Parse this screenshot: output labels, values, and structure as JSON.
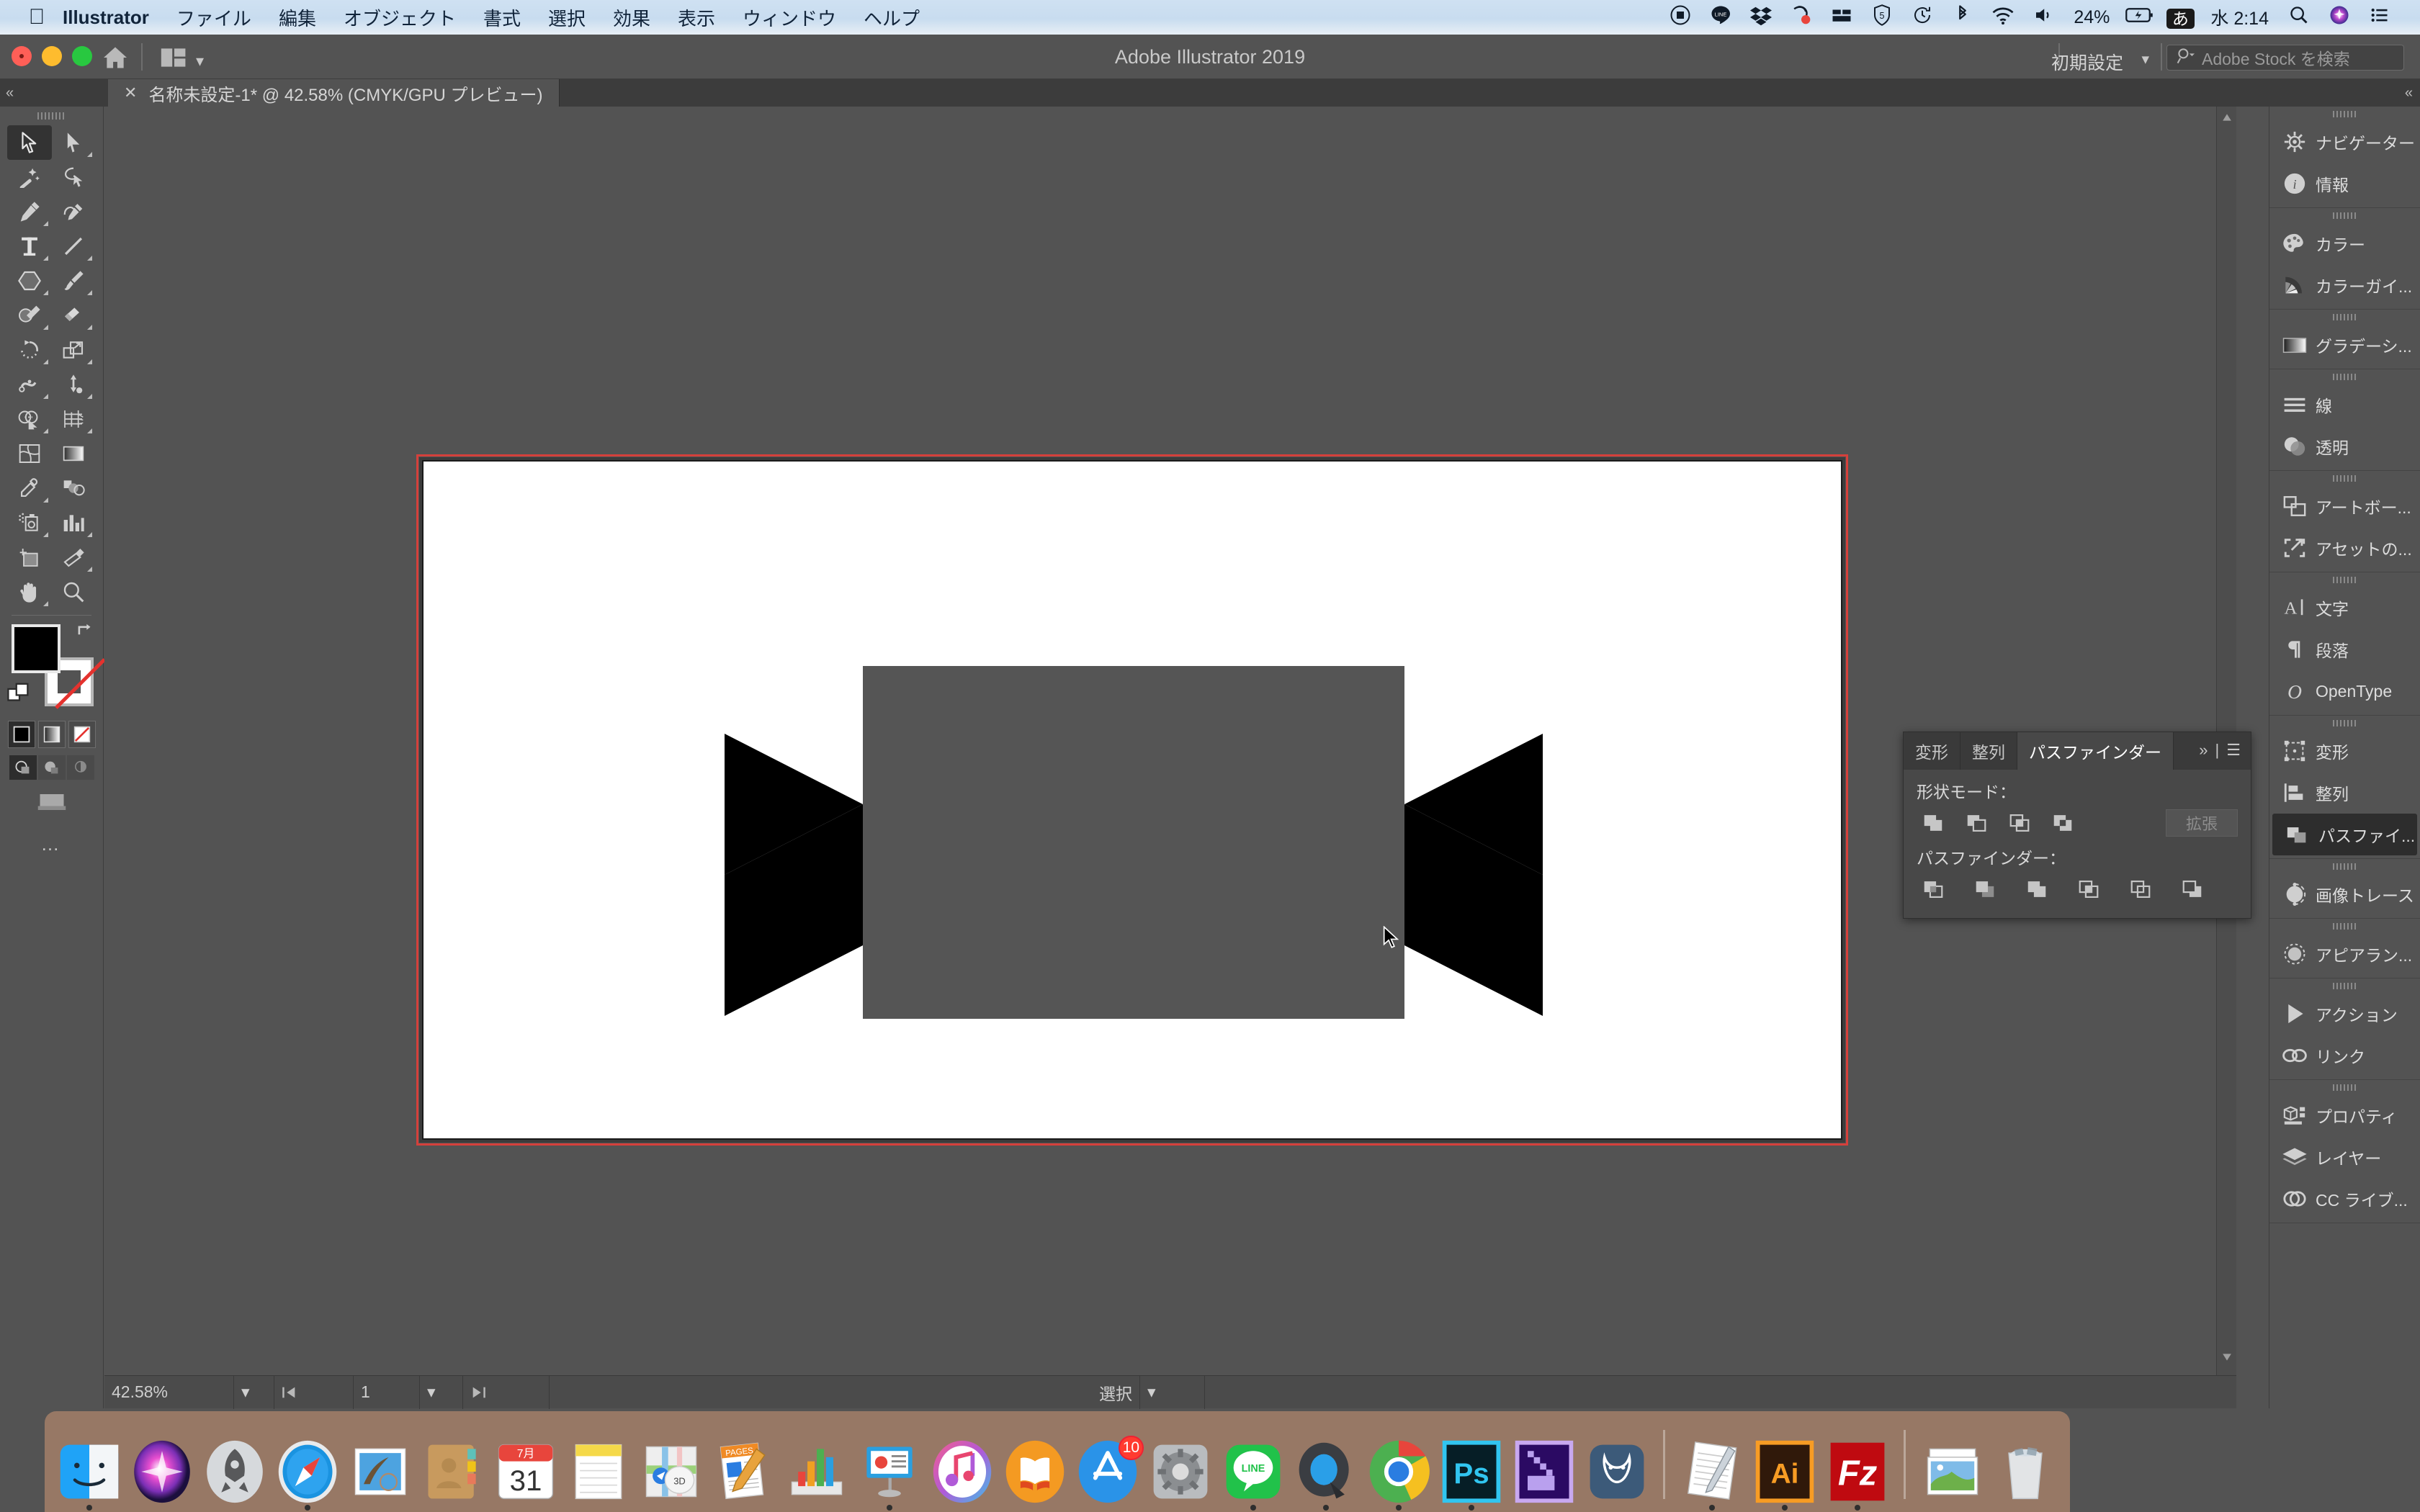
{
  "menubar": {
    "apple_icon": "apple-icon",
    "items": [
      "Illustrator",
      "ファイル",
      "編集",
      "オブジェクト",
      "書式",
      "選択",
      "効果",
      "表示",
      "ウィンドウ",
      "ヘルプ"
    ],
    "status": {
      "battery_percent": "24%",
      "ime": "あ",
      "clock": "水 2:14",
      "icons": [
        "screen-record-icon",
        "line-icon",
        "dropbox-icon",
        "cleaner-icon",
        "storage-icon",
        "shield5-icon",
        "timemachine-icon",
        "bluetooth-icon",
        "wifi-icon",
        "volume-icon",
        "battery-icon",
        "spotlight-icon",
        "siri-icon",
        "control-center-icon"
      ]
    }
  },
  "titlebar": {
    "app_title": "Adobe Illustrator 2019",
    "workspace": "初期設定",
    "stock_placeholder": "Adobe Stock を検索",
    "home_icon": "home-icon",
    "arrange_icon": "arrange-documents-icon"
  },
  "tabbar": {
    "document_tab": "名称未設定-1* @ 42.58% (CMYK/GPU プレビュー)",
    "close_label": "✕"
  },
  "toolbar": {
    "tools": [
      {
        "name": "selection-tool",
        "selected": true,
        "corner": false
      },
      {
        "name": "direct-selection-tool",
        "selected": false,
        "corner": true
      },
      {
        "name": "magic-wand-tool",
        "selected": false,
        "corner": false
      },
      {
        "name": "lasso-tool",
        "selected": false,
        "corner": false
      },
      {
        "name": "pen-tool",
        "selected": false,
        "corner": true
      },
      {
        "name": "curvature-tool",
        "selected": false,
        "corner": false
      },
      {
        "name": "type-tool",
        "selected": false,
        "corner": true
      },
      {
        "name": "line-segment-tool",
        "selected": false,
        "corner": true
      },
      {
        "name": "shape-tool",
        "selected": false,
        "corner": true
      },
      {
        "name": "paintbrush-tool",
        "selected": false,
        "corner": true
      },
      {
        "name": "shaper-tool",
        "selected": false,
        "corner": true
      },
      {
        "name": "eraser-tool",
        "selected": false,
        "corner": true
      },
      {
        "name": "rotate-tool",
        "selected": false,
        "corner": true
      },
      {
        "name": "scale-tool",
        "selected": false,
        "corner": true
      },
      {
        "name": "width-tool",
        "selected": false,
        "corner": true
      },
      {
        "name": "free-transform-tool",
        "selected": false,
        "corner": true
      },
      {
        "name": "shape-builder-tool",
        "selected": false,
        "corner": true
      },
      {
        "name": "perspective-grid-tool",
        "selected": false,
        "corner": true
      },
      {
        "name": "mesh-tool",
        "selected": false,
        "corner": false
      },
      {
        "name": "gradient-tool",
        "selected": false,
        "corner": false
      },
      {
        "name": "eyedropper-tool",
        "selected": false,
        "corner": true
      },
      {
        "name": "blend-tool",
        "selected": false,
        "corner": false
      },
      {
        "name": "symbol-sprayer-tool",
        "selected": false,
        "corner": true
      },
      {
        "name": "column-graph-tool",
        "selected": false,
        "corner": true
      },
      {
        "name": "artboard-tool",
        "selected": false,
        "corner": false
      },
      {
        "name": "slice-tool",
        "selected": false,
        "corner": true
      },
      {
        "name": "hand-tool",
        "selected": false,
        "corner": true
      },
      {
        "name": "zoom-tool",
        "selected": false,
        "corner": false
      }
    ],
    "fill_color": "#000000",
    "stroke_color": "#ffffff",
    "swap_icon": "swap-fill-stroke-icon",
    "default_icon": "default-fill-stroke-icon",
    "modes": [
      "color-mode",
      "gradient-mode",
      "none-mode"
    ],
    "draw_modes": [
      "draw-normal",
      "draw-behind",
      "draw-inside"
    ],
    "screen_mode_icon": "change-screen-mode-icon",
    "more_tools": "…"
  },
  "canvas": {
    "artboard_background": "#ffffff",
    "bleed_color": "#d5403b",
    "cursor_icon": "arrow-cursor",
    "artwork": {
      "name": "ribbon-banner-shape",
      "banner_color": "#555555",
      "tail_color": "#000000",
      "shadow_color": "#262629"
    }
  },
  "statusbar": {
    "zoom": "42.58%",
    "page": "1",
    "tool_label": "選択"
  },
  "dock_panels": [
    {
      "group": 1,
      "items": [
        {
          "icon": "navigator-icon",
          "label": "ナビゲーター"
        },
        {
          "icon": "info-icon",
          "label": "情報"
        }
      ]
    },
    {
      "group": 2,
      "items": [
        {
          "icon": "color-icon",
          "label": "カラー"
        },
        {
          "icon": "color-guide-icon",
          "label": "カラーガイ..."
        }
      ]
    },
    {
      "group": 3,
      "items": [
        {
          "icon": "gradient-icon",
          "label": "グラデーシ..."
        }
      ]
    },
    {
      "group": 4,
      "items": [
        {
          "icon": "stroke-icon",
          "label": "線"
        },
        {
          "icon": "transparency-icon",
          "label": "透明"
        }
      ]
    },
    {
      "group": 5,
      "items": [
        {
          "icon": "artboards-icon",
          "label": "アートボー..."
        },
        {
          "icon": "asset-export-icon",
          "label": "アセットの..."
        }
      ]
    },
    {
      "group": 6,
      "items": [
        {
          "icon": "character-icon",
          "label": "文字"
        },
        {
          "icon": "paragraph-icon",
          "label": "段落"
        },
        {
          "icon": "opentype-icon",
          "label": "OpenType"
        }
      ]
    },
    {
      "group": 7,
      "items": [
        {
          "icon": "transform-icon",
          "label": "変形"
        },
        {
          "icon": "align-icon",
          "label": "整列"
        },
        {
          "icon": "pathfinder-icon",
          "label": "パスファイ...",
          "active": true
        }
      ]
    },
    {
      "group": 8,
      "items": [
        {
          "icon": "image-trace-icon",
          "label": "画像トレース"
        }
      ]
    },
    {
      "group": 9,
      "items": [
        {
          "icon": "appearance-icon",
          "label": "アピアラン..."
        }
      ]
    },
    {
      "group": 10,
      "items": [
        {
          "icon": "actions-icon",
          "label": "アクション"
        },
        {
          "icon": "links-icon",
          "label": "リンク"
        }
      ]
    },
    {
      "group": 11,
      "items": [
        {
          "icon": "properties-icon",
          "label": "プロパティ"
        },
        {
          "icon": "layers-icon",
          "label": "レイヤー"
        },
        {
          "icon": "cc-libraries-icon",
          "label": "CC ライブ..."
        }
      ]
    }
  ],
  "pathfinder_panel": {
    "tabs": [
      {
        "label": "変形",
        "selected": false
      },
      {
        "label": "整列",
        "selected": false
      },
      {
        "label": "パスファインダー",
        "selected": true
      }
    ],
    "overflow_icon": "chevron-double-right-icon",
    "menu_icon": "panel-menu-icon",
    "shape_modes_label": "形状モード：",
    "shape_mode_buttons": [
      "unite-icon",
      "minus-front-icon",
      "intersect-icon",
      "exclude-icon"
    ],
    "expand_label": "拡張",
    "pathfinders_label": "パスファインダー：",
    "pathfinder_buttons": [
      "divide-icon",
      "trim-icon",
      "merge-icon",
      "crop-icon",
      "outline-icon",
      "minus-back-icon"
    ]
  },
  "mac_dock": {
    "items": [
      {
        "name": "finder",
        "running": true
      },
      {
        "name": "siri",
        "running": false
      },
      {
        "name": "launchpad",
        "running": false
      },
      {
        "name": "safari",
        "running": true
      },
      {
        "name": "mail",
        "running": false
      },
      {
        "name": "contacts",
        "running": false
      },
      {
        "name": "calendar",
        "running": false,
        "month": "7月",
        "day": "31"
      },
      {
        "name": "notes",
        "running": false
      },
      {
        "name": "maps",
        "running": false
      },
      {
        "name": "pages",
        "running": false
      },
      {
        "name": "numbers",
        "running": false
      },
      {
        "name": "keynote",
        "running": true
      },
      {
        "name": "itunes",
        "running": false
      },
      {
        "name": "books",
        "running": false
      },
      {
        "name": "app-store",
        "running": false,
        "badge": "10"
      },
      {
        "name": "system-preferences",
        "running": false
      },
      {
        "name": "line",
        "running": true
      },
      {
        "name": "quicktime",
        "running": true
      },
      {
        "name": "google-chrome",
        "running": true
      },
      {
        "name": "photoshop",
        "running": true
      },
      {
        "name": "adobe-xd",
        "running": false
      },
      {
        "name": "handbrake",
        "running": false
      },
      {
        "name": "separator"
      },
      {
        "name": "textedit",
        "running": true
      },
      {
        "name": "illustrator",
        "running": true
      },
      {
        "name": "filezilla",
        "running": true
      },
      {
        "name": "separator2"
      },
      {
        "name": "downloads-stack",
        "running": false
      },
      {
        "name": "trash",
        "running": false
      }
    ]
  }
}
